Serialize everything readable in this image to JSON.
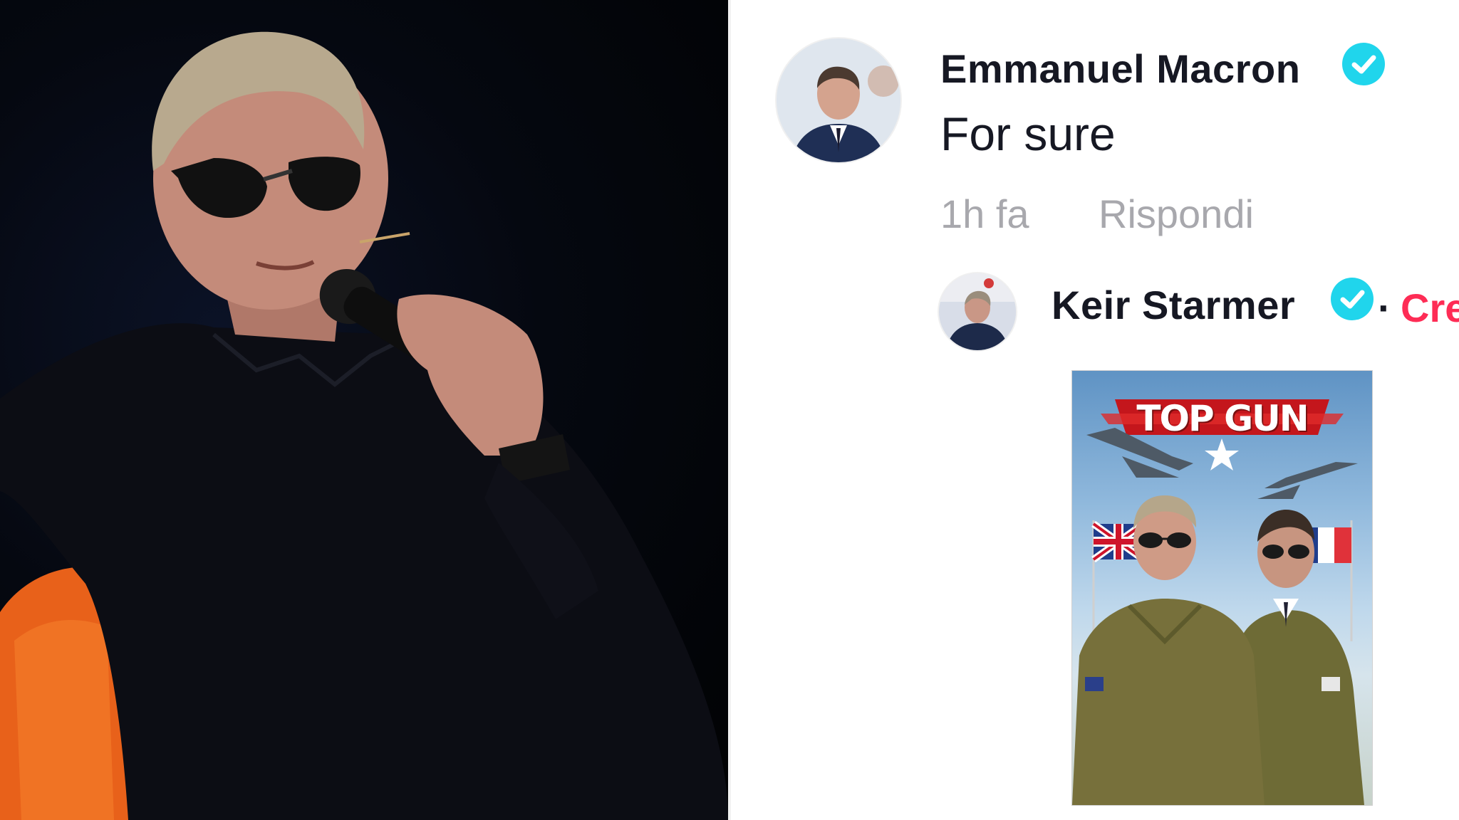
{
  "photo_panel": {
    "image": "man-in-sunglasses-with-microphone"
  },
  "comment": {
    "author": "Emmanuel Macron",
    "text": "For sure",
    "time": "1h fa",
    "reply_label": "Rispondi",
    "verified_icon": "verified-check-icon"
  },
  "reply": {
    "author": "Keir Starmer",
    "separator": "·",
    "creator_label": "Cre",
    "verified_icon": "verified-check-icon"
  },
  "poster": {
    "title": "TOP GUN"
  },
  "colors": {
    "verified": "#20d5ec",
    "creator": "#fe2c55",
    "text": "#161823",
    "muted": "#a8a8ad"
  }
}
